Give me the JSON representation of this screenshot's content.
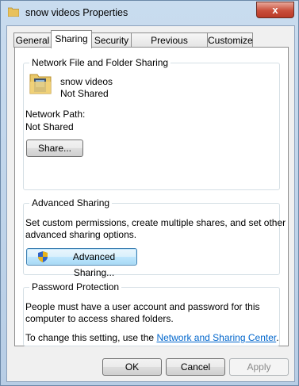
{
  "window": {
    "title": "snow videos Properties",
    "close_label": "x"
  },
  "tabs": [
    {
      "label": "General"
    },
    {
      "label": "Sharing"
    },
    {
      "label": "Security"
    },
    {
      "label": "Previous Versions"
    },
    {
      "label": "Customize"
    }
  ],
  "network_sharing": {
    "group_label": "Network File and Folder Sharing",
    "folder_name": "snow videos",
    "status": "Not Shared",
    "path_label": "Network Path:",
    "path_value": "Not Shared",
    "share_button": "Share..."
  },
  "advanced_sharing": {
    "group_label": "Advanced Sharing",
    "description_line1": "Set custom permissions, create multiple shares, and set other",
    "description_line2": "advanced sharing options.",
    "button_label": "Advanced Sharing..."
  },
  "password_protection": {
    "group_label": "Password Protection",
    "line1": "People must have a user account and password for this",
    "line2": "computer to access shared folders.",
    "change_text": "To change this setting, use the ",
    "link_text": "Network and Sharing Center",
    "period": "."
  },
  "footer": {
    "ok": "OK",
    "cancel": "Cancel",
    "apply": "Apply"
  }
}
